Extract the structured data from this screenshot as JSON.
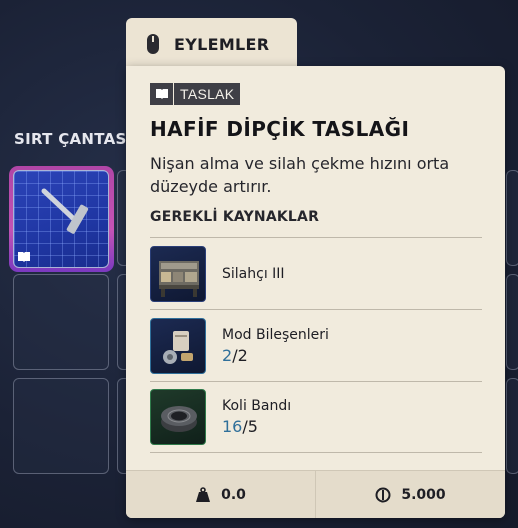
{
  "inventory": {
    "title": "SIRT ÇANTASI",
    "right_title_fragment": "I"
  },
  "actions": {
    "label": "EYLEMLER",
    "icon": "mouse-icon"
  },
  "tooltip": {
    "type_label": "TASLAK",
    "type_icon": "book-icon",
    "title": "HAFİF DİPÇİK TASLAĞI",
    "description": "Nişan alma ve silah çekme hızını orta düzeyde artırır.",
    "requirements_heading": "GEREKLİ KAYNAKLAR",
    "requirements": [
      {
        "name": "Silahçı III",
        "icon": "gunsmith-bench-icon"
      },
      {
        "name": "Mod Bileşenleri",
        "have": "2",
        "sep": "/",
        "need": "2",
        "icon": "mod-components-icon"
      },
      {
        "name": "Koli Bandı",
        "have": "16",
        "sep": "/",
        "need": "5",
        "icon": "duct-tape-icon"
      }
    ],
    "weight": "0.0",
    "price": "5.000"
  },
  "colors": {
    "card_bg": "#f1ebdd",
    "have_count": "#2f6f9a",
    "slot_blueprint": "#1f36a3",
    "slot_glow": "#e05ac8"
  }
}
